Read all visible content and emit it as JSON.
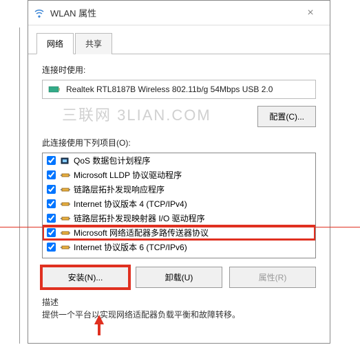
{
  "window": {
    "title": "WLAN 属性",
    "close_label": "×"
  },
  "tabs": {
    "network": "网络",
    "sharing": "共享"
  },
  "connect_using_label": "连接时使用:",
  "adapter_name": "Realtek RTL8187B Wireless 802.11b/g 54Mbps USB 2.0",
  "configure_btn": "配置(C)...",
  "items_label": "此连接使用下列项目(O):",
  "items": [
    {
      "checked": true,
      "icon": "qos",
      "text": "QoS 数据包计划程序"
    },
    {
      "checked": true,
      "icon": "proto",
      "text": "Microsoft LLDP 协议驱动程序"
    },
    {
      "checked": true,
      "icon": "proto",
      "text": "链路层拓扑发现响应程序"
    },
    {
      "checked": true,
      "icon": "proto",
      "text": "Internet 协议版本 4 (TCP/IPv4)"
    },
    {
      "checked": true,
      "icon": "proto",
      "text": "链路层拓扑发现映射器 I/O 驱动程序"
    },
    {
      "checked": true,
      "icon": "proto",
      "text": "Microsoft 网络适配器多路传送器协议",
      "highlighted": true
    },
    {
      "checked": true,
      "icon": "proto",
      "text": "Internet 协议版本 6 (TCP/IPv6)"
    }
  ],
  "buttons": {
    "install": "安装(N)...",
    "uninstall": "卸载(U)",
    "properties": "属性(R)"
  },
  "description": {
    "label": "描述",
    "text": "提供一个平台以实现网络适配器负载平衡和故障转移。"
  },
  "watermark": "三联网 3LIAN.COM"
}
